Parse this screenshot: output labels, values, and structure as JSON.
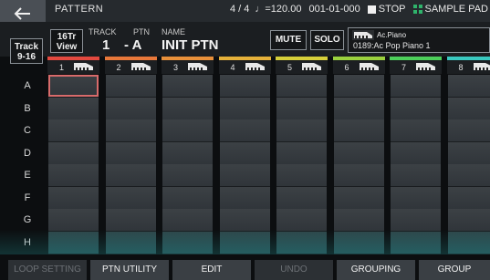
{
  "header": {
    "title": "PATTERN",
    "time_signature": "4 / 4",
    "tempo": "♩=120.00",
    "position": "001-01-000",
    "transport": "STOP",
    "mode": "SAMPLE PAD"
  },
  "controls": {
    "view_label_line1": "16Tr",
    "view_label_line2": "View",
    "track_btn_line1": "Track",
    "track_btn_line2": "9-16",
    "track_label": "TRACK",
    "ptn_label": "PTN",
    "name_label": "NAME",
    "track_value": "1",
    "ptn_value": "- A",
    "name_value": "INIT PTN",
    "mute_label": "MUTE",
    "solo_label": "SOLO",
    "tone_category": "Ac.Piano",
    "tone_name": "0189:Ac Pop Piano 1"
  },
  "tracks": [
    {
      "num": "1",
      "color": "#e3493f"
    },
    {
      "num": "2",
      "color": "#e8783a"
    },
    {
      "num": "3",
      "color": "#e8903a"
    },
    {
      "num": "4",
      "color": "#e6b13a"
    },
    {
      "num": "5",
      "color": "#d6cf3a"
    },
    {
      "num": "6",
      "color": "#9bd13e"
    },
    {
      "num": "7",
      "color": "#4ccf5a"
    },
    {
      "num": "8",
      "color": "#39c9c0"
    }
  ],
  "rows": [
    "A",
    "B",
    "C",
    "D",
    "E",
    "F",
    "G",
    "H"
  ],
  "bottom_buttons": [
    {
      "label": "LOOP SETTING",
      "enabled": false
    },
    {
      "label": "PTN UTILITY",
      "enabled": true
    },
    {
      "label": "EDIT",
      "enabled": true
    },
    {
      "label": "UNDO",
      "enabled": false
    },
    {
      "label": "GROUPING",
      "enabled": true
    },
    {
      "label": "GROUP",
      "enabled": true
    }
  ],
  "icons": {
    "back": "back-arrow-icon",
    "transport": "stop-square-icon",
    "pad": "sample-pad-grid-icon",
    "instrument": "grand-piano-icon"
  }
}
